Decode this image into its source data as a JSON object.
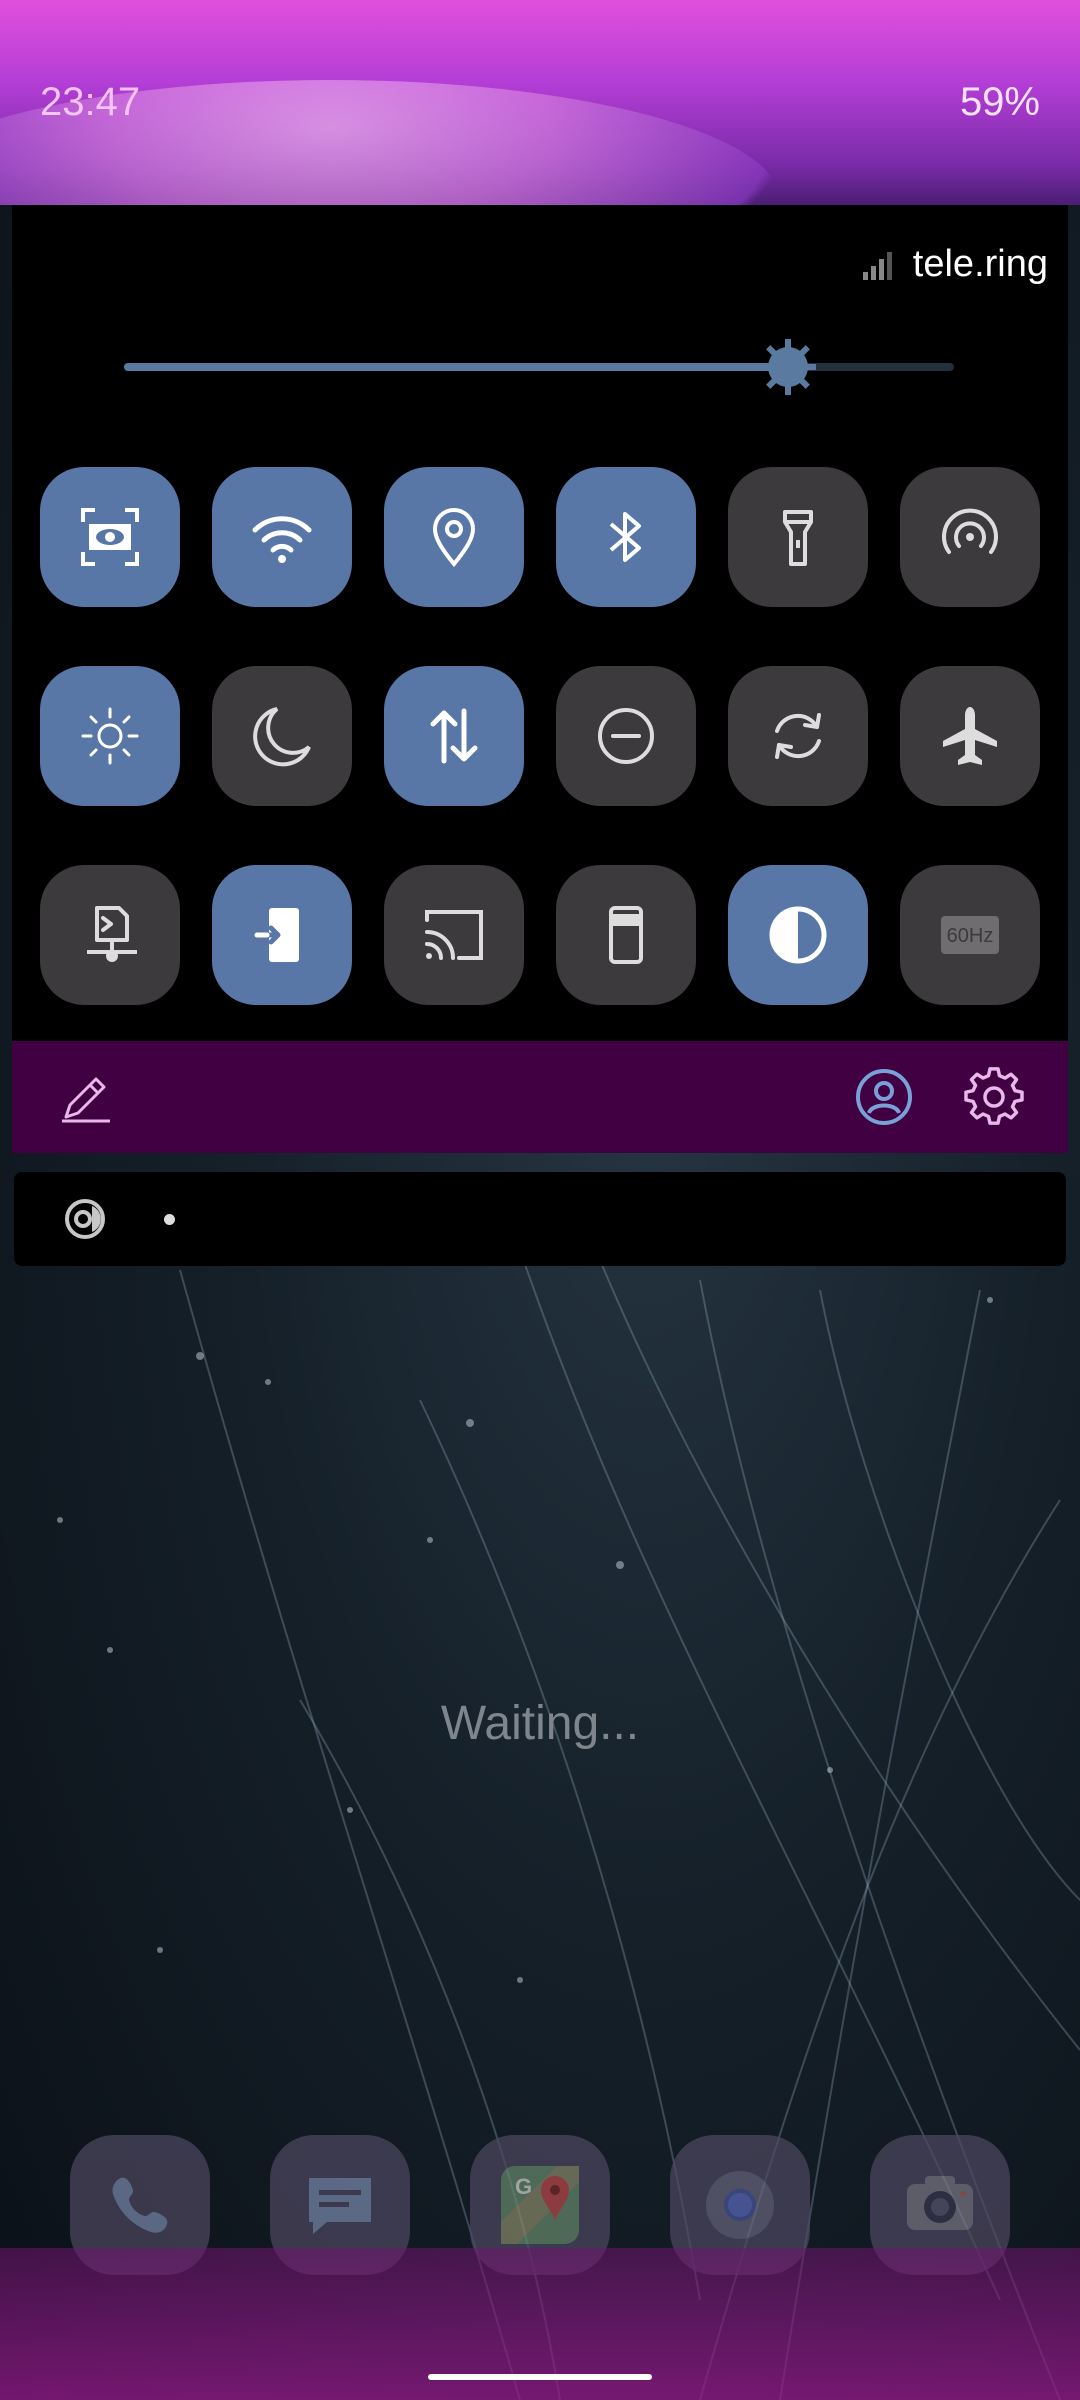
{
  "status_bar": {
    "time": "23:47",
    "battery": "59%"
  },
  "carrier": {
    "name": "tele.ring"
  },
  "brightness": {
    "level": 0.8
  },
  "tiles": [
    [
      {
        "icon": "screen-eye-icon",
        "on": true
      },
      {
        "icon": "wifi-icon",
        "on": true
      },
      {
        "icon": "location-icon",
        "on": true
      },
      {
        "icon": "bluetooth-icon",
        "on": true
      },
      {
        "icon": "flashlight-icon",
        "on": false
      },
      {
        "icon": "hotspot-icon",
        "on": false
      }
    ],
    [
      {
        "icon": "brightness-auto-icon",
        "on": true
      },
      {
        "icon": "night-mode-icon",
        "on": false
      },
      {
        "icon": "mobile-data-icon",
        "on": true
      },
      {
        "icon": "do-not-disturb-icon",
        "on": false
      },
      {
        "icon": "auto-rotate-icon",
        "on": false
      },
      {
        "icon": "airplane-mode-icon",
        "on": false
      }
    ],
    [
      {
        "icon": "network-share-icon",
        "on": false
      },
      {
        "icon": "nfc-phone-icon",
        "on": true
      },
      {
        "icon": "cast-icon",
        "on": false
      },
      {
        "icon": "phone-device-icon",
        "on": false
      },
      {
        "icon": "invert-colors-icon",
        "on": true
      },
      {
        "icon": "refresh-rate-icon",
        "on": false
      }
    ]
  ],
  "refresh_rate_label": "60Hz",
  "widget": {
    "status": "Waiting..."
  },
  "dock": [
    "phone-app-icon",
    "messages-app-icon",
    "maps-app-icon",
    "browser-app-icon",
    "camera-app-icon"
  ],
  "colors": {
    "tile_on": "#5877a7",
    "tile_off": "#3c3a3c",
    "footer_bg": "#400041"
  }
}
